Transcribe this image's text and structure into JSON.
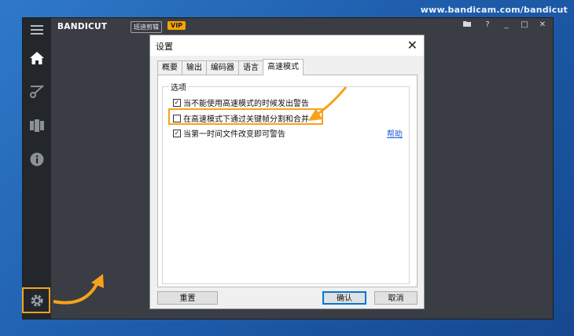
{
  "watermark": "www.bandicam.com/bandicut",
  "app": {
    "logo_main": "BANDI",
    "logo_cut": "CUT",
    "brand_cn": "班迪剪辑",
    "vip": "VIP",
    "sidebar": [
      {
        "icon": "menu-icon"
      },
      {
        "icon": "home-icon"
      },
      {
        "icon": "cut-icon"
      },
      {
        "icon": "film-icon"
      },
      {
        "icon": "info-icon"
      },
      {
        "icon": "gear-icon"
      }
    ],
    "window_controls": {
      "folder": "▀",
      "help": "?",
      "minimize": "_",
      "maximize": "□",
      "close": "✕"
    }
  },
  "dialog": {
    "title": "设置",
    "close": "✕",
    "tabs": [
      {
        "label": "概要",
        "active": false
      },
      {
        "label": "输出",
        "active": false
      },
      {
        "label": "编码器",
        "active": false
      },
      {
        "label": "语言",
        "active": false
      },
      {
        "label": "高速模式",
        "active": true
      }
    ],
    "group_label": "选项",
    "options": [
      {
        "label": "当不能使用高速模式的时候发出警告",
        "checked": true,
        "mark": "✓"
      },
      {
        "label": "在高速模式下通过关键帧分割和合并",
        "checked": false,
        "mark": ""
      },
      {
        "label": "当第一时间文件改变即可警告",
        "checked": true,
        "mark": "✓"
      }
    ],
    "help_link": "帮助",
    "buttons": {
      "reset": "重置",
      "ok": "确认",
      "cancel": "取消"
    }
  },
  "colors": {
    "highlight": "#f7a21b",
    "link": "#1a5fd6",
    "sidebar": "#23262b",
    "app_bg": "#3a3d44"
  }
}
